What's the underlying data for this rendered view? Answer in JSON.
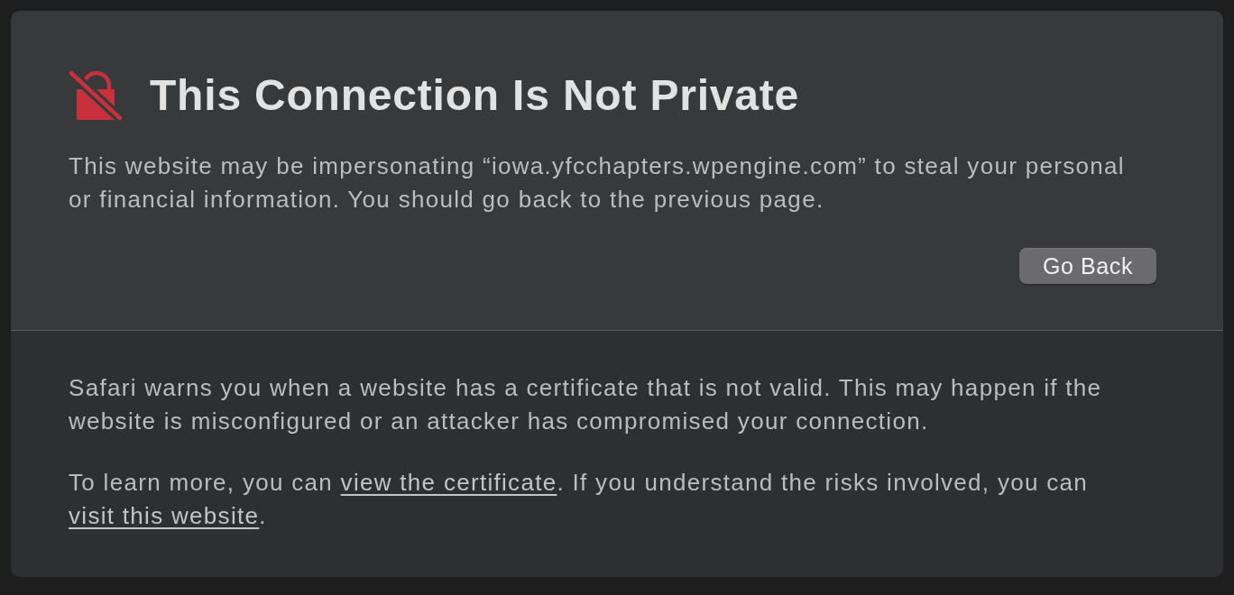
{
  "title": "This Connection Is Not Private",
  "warning": "This website may be impersonating “iowa.yfcchapters.wpengine.com” to steal your personal or financial information. You should go back to the previous page.",
  "go_back_button": "Go Back",
  "explanation": "Safari warns you when a website has a certificate that is not valid. This may happen if the website is misconfigured or an attacker has compromised your connection.",
  "learn_more": [
    {
      "kind": "text",
      "text": "To learn more, you can "
    },
    {
      "kind": "link",
      "text": "view the certificate"
    },
    {
      "kind": "text",
      "text": ". If you understand the risks involved, you can "
    },
    {
      "kind": "link",
      "text": "visit this website"
    },
    {
      "kind": "text",
      "text": "."
    }
  ]
}
